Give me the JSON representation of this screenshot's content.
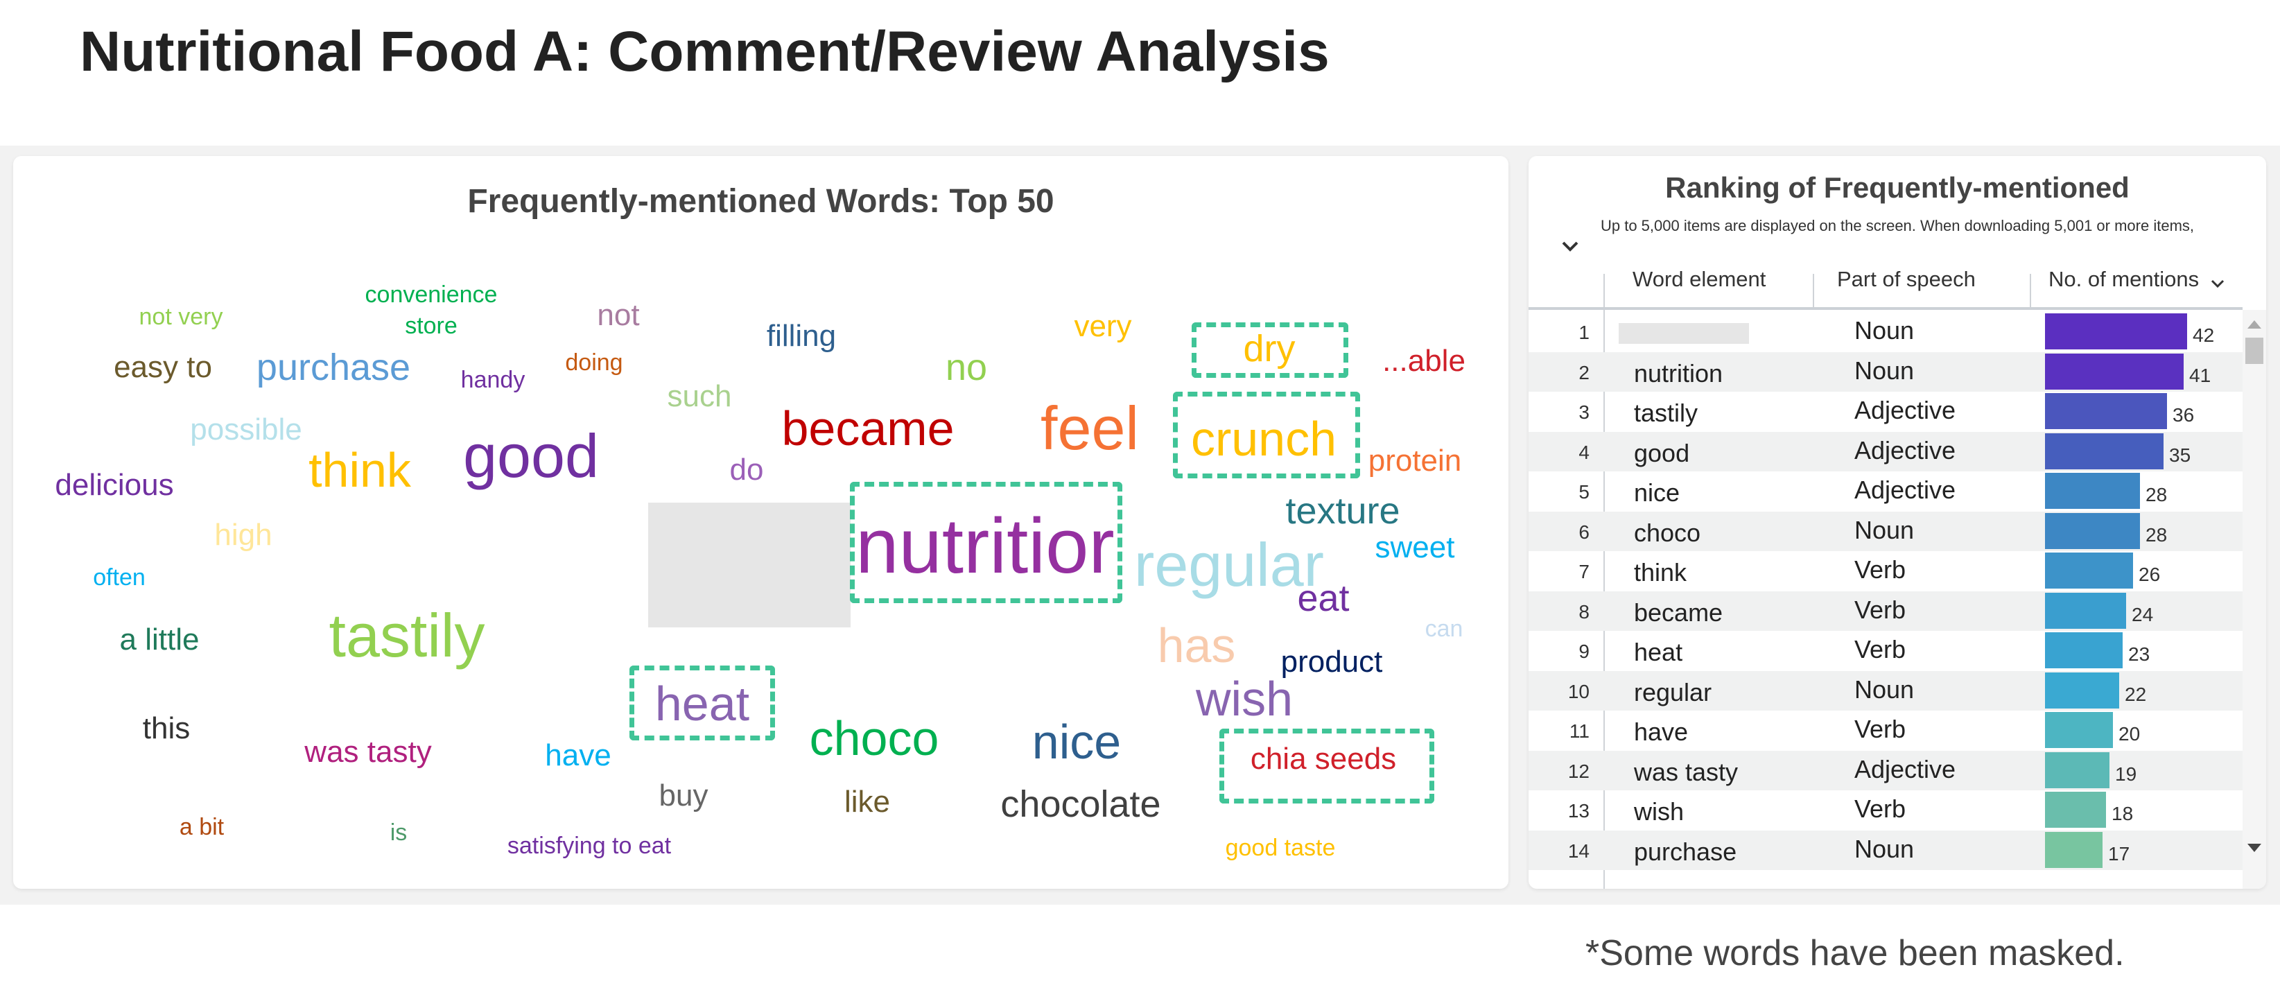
{
  "page": {
    "title": "Nutritional Food A: Comment/Review Analysis",
    "footnote": "*Some words have been masked."
  },
  "word_cloud": {
    "title": "Frequently-mentioned Words: Top 50",
    "highlight_color": "#40c497",
    "words": [
      {
        "text": "not very",
        "color": "#92d050",
        "size": "small"
      },
      {
        "text": "convenience",
        "color": "#00b050",
        "size": "small"
      },
      {
        "text": "store",
        "color": "#00b050",
        "size": "small"
      },
      {
        "text": "not",
        "color": "#a87ca0",
        "size": "medium"
      },
      {
        "text": "filling",
        "color": "#2e5f8e",
        "size": "medium"
      },
      {
        "text": "very",
        "color": "#ffc000",
        "size": "medium"
      },
      {
        "text": "dry",
        "color": "#ffc000",
        "size": "large",
        "highlighted": true
      },
      {
        "text": "...able",
        "color": "#d0202a",
        "size": "medium"
      },
      {
        "text": "easy to",
        "color": "#6b5a2c",
        "size": "medium"
      },
      {
        "text": "purchase",
        "color": "#5b9bd5",
        "size": "large"
      },
      {
        "text": "handy",
        "color": "#7030a0",
        "size": "small"
      },
      {
        "text": "doing",
        "color": "#c55a11",
        "size": "small"
      },
      {
        "text": "such",
        "color": "#a9d18e",
        "size": "medium"
      },
      {
        "text": "no",
        "color": "#92d050",
        "size": "large"
      },
      {
        "text": "became",
        "color": "#c00000",
        "size": "xlarge"
      },
      {
        "text": "feel",
        "color": "#f57234",
        "size": "xxlarge"
      },
      {
        "text": "crunchy",
        "color": "#ffc000",
        "size": "xlarge",
        "highlighted": true
      },
      {
        "text": "protein",
        "color": "#f57234",
        "size": "medium"
      },
      {
        "text": "possible",
        "color": "#b4e0ea",
        "size": "medium"
      },
      {
        "text": "think",
        "color": "#ffc000",
        "size": "xlarge"
      },
      {
        "text": "good",
        "color": "#7030a0",
        "size": "xxlarge"
      },
      {
        "text": "do",
        "color": "#9b5fb8",
        "size": "medium"
      },
      {
        "text": "delicious",
        "color": "#7030a0",
        "size": "medium"
      },
      {
        "text": "nutrition",
        "color": "#9530a0",
        "size": "xxxlarge",
        "highlighted": true
      },
      {
        "text": "texture",
        "color": "#277783",
        "size": "large"
      },
      {
        "text": "high",
        "color": "#ffe699",
        "size": "medium"
      },
      {
        "text": "regular",
        "color": "#a8dce6",
        "size": "xxlarge"
      },
      {
        "text": "sweet",
        "color": "#00b0f0",
        "size": "medium"
      },
      {
        "text": "often",
        "color": "#00b0f0",
        "size": "small"
      },
      {
        "text": "eat",
        "color": "#7030a0",
        "size": "large"
      },
      {
        "text": "a little",
        "color": "#1f7a5a",
        "size": "medium"
      },
      {
        "text": "tastily",
        "color": "#92d050",
        "size": "xxlarge"
      },
      {
        "text": "has",
        "color": "#f8cbad",
        "size": "xlarge"
      },
      {
        "text": "can",
        "color": "#c6dbef",
        "size": "small"
      },
      {
        "text": "product",
        "color": "#002060",
        "size": "medium"
      },
      {
        "text": "heat",
        "color": "#8864b0",
        "size": "xlarge",
        "highlighted": true
      },
      {
        "text": "wish",
        "color": "#8864b0",
        "size": "xlarge"
      },
      {
        "text": "this",
        "color": "#333333",
        "size": "medium"
      },
      {
        "text": "was tasty",
        "color": "#b0207e",
        "size": "medium"
      },
      {
        "text": "have",
        "color": "#00b0f0",
        "size": "medium"
      },
      {
        "text": "choco",
        "color": "#00b050",
        "size": "xlarge"
      },
      {
        "text": "nice",
        "color": "#2e5f8e",
        "size": "xlarge"
      },
      {
        "text": "chia seeds",
        "color": "#d0202a",
        "size": "medium",
        "highlighted": true
      },
      {
        "text": "buy",
        "color": "#666666",
        "size": "medium"
      },
      {
        "text": "like",
        "color": "#6b5a2c",
        "size": "medium"
      },
      {
        "text": "chocolate",
        "color": "#404040",
        "size": "large"
      },
      {
        "text": "a bit",
        "color": "#b04a10",
        "size": "small"
      },
      {
        "text": "is",
        "color": "#4e9a6a",
        "size": "small"
      },
      {
        "text": "satisfying to eat",
        "color": "#7030a0",
        "size": "small"
      },
      {
        "text": "good taste",
        "color": "#ffc000",
        "size": "small"
      }
    ]
  },
  "ranking": {
    "title": "Ranking of Frequently-mentioned",
    "subtitle": "Up to 5,000 items are displayed on the screen. When downloading 5,001 or more items,",
    "columns": {
      "word": "Word element",
      "pos": "Part of speech",
      "mentions": "No. of mentions"
    },
    "max_value": 42,
    "rows": [
      {
        "rank": "1",
        "word": "",
        "masked": true,
        "pos": "Noun",
        "value": 42,
        "color": "#5b2fc0"
      },
      {
        "rank": "2",
        "word": "nutrition",
        "pos": "Noun",
        "value": 41,
        "color": "#5a31c0"
      },
      {
        "rank": "3",
        "word": "tastily",
        "pos": "Adjective",
        "value": 36,
        "color": "#4b56bd"
      },
      {
        "rank": "4",
        "word": "good",
        "pos": "Adjective",
        "value": 35,
        "color": "#465ebd"
      },
      {
        "rank": "5",
        "word": "nice",
        "pos": "Adjective",
        "value": 28,
        "color": "#3d87c4"
      },
      {
        "rank": "6",
        "word": "choco",
        "pos": "Noun",
        "value": 28,
        "color": "#3d87c4"
      },
      {
        "rank": "7",
        "word": "think",
        "pos": "Verb",
        "value": 26,
        "color": "#3d93c9"
      },
      {
        "rank": "8",
        "word": "became",
        "pos": "Verb",
        "value": 24,
        "color": "#3a9ecf"
      },
      {
        "rank": "9",
        "word": "heat",
        "pos": "Verb",
        "value": 23,
        "color": "#39a3d1"
      },
      {
        "rank": "10",
        "word": "regular",
        "pos": "Noun",
        "value": 22,
        "color": "#3aa9d2"
      },
      {
        "rank": "11",
        "word": "have",
        "pos": "Verb",
        "value": 20,
        "color": "#4db5c2"
      },
      {
        "rank": "12",
        "word": "was tasty",
        "pos": "Adjective",
        "value": 19,
        "color": "#5cb9b6"
      },
      {
        "rank": "13",
        "word": "wish",
        "pos": "Verb",
        "value": 18,
        "color": "#6abeac"
      },
      {
        "rank": "14",
        "word": "purchase",
        "pos": "Noun",
        "value": 17,
        "color": "#78c5a0"
      }
    ]
  }
}
